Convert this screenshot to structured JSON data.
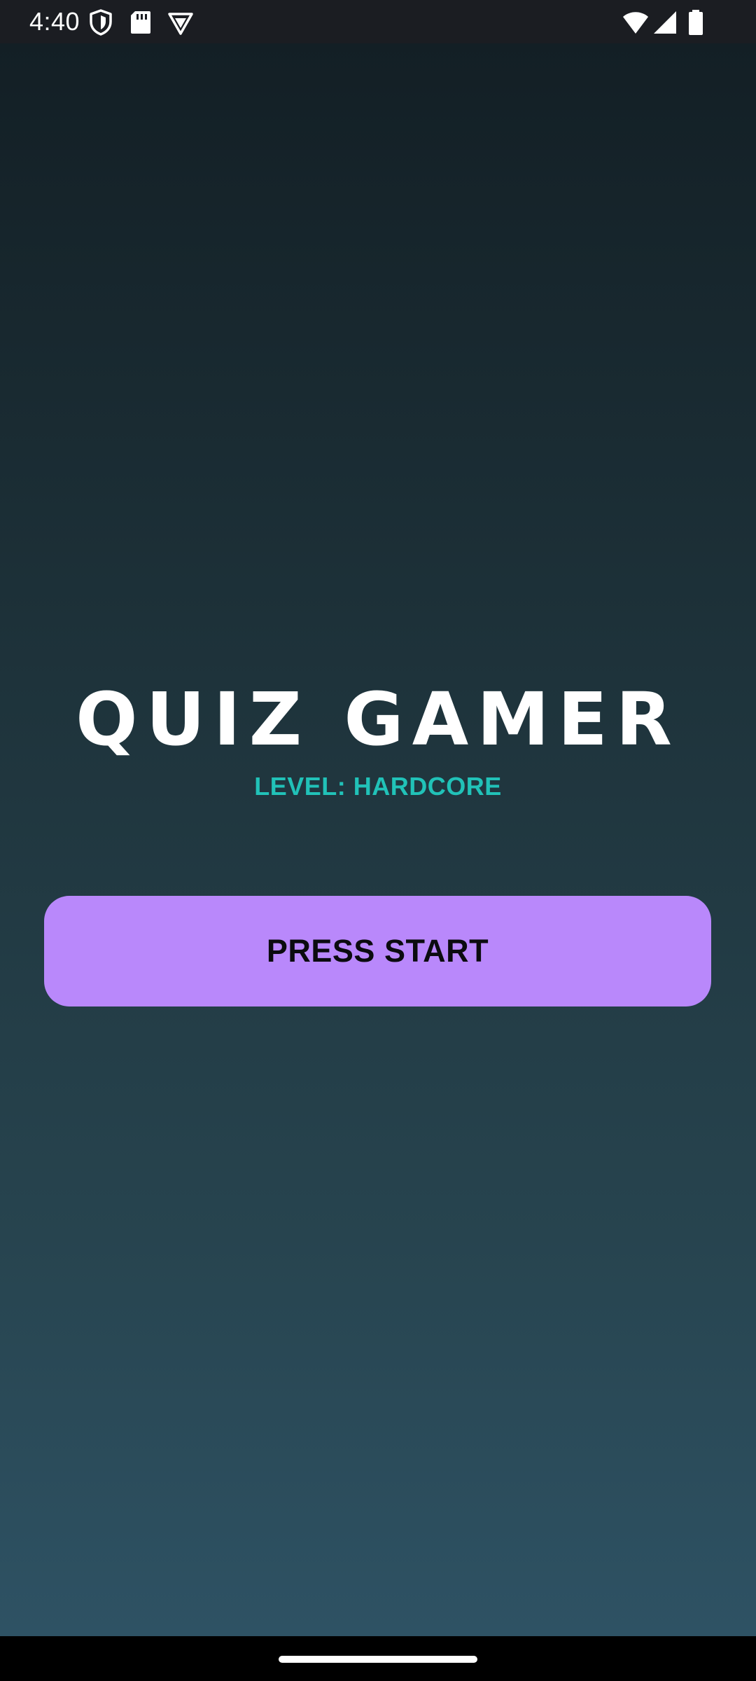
{
  "status_bar": {
    "time": "4:40",
    "left_icons": [
      "shield-icon",
      "sd-card-icon",
      "vpn-badge-icon"
    ],
    "right_icons": [
      "wifi-icon",
      "cellular-signal-icon",
      "battery-icon"
    ]
  },
  "app": {
    "title": "QUIZ GAMER",
    "subtitle": "LEVEL: HARDCORE",
    "start_button_label": "PRESS START"
  },
  "colors": {
    "background_top": "#131f25",
    "background_bottom": "#2e5264",
    "accent_teal": "#21c2b8",
    "button_purple": "#b988fb",
    "button_text": "#0b0b0f"
  }
}
